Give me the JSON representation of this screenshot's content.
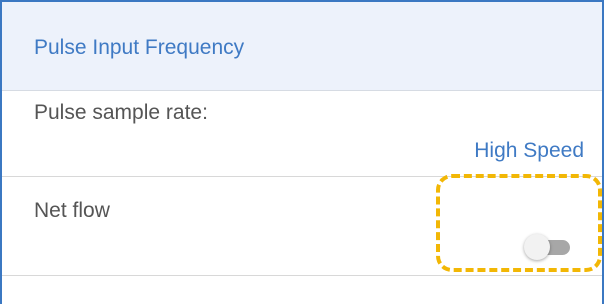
{
  "header": {
    "title": "Pulse Input Frequency"
  },
  "settings": [
    {
      "label": "Pulse sample rate:",
      "value": "High Speed"
    },
    {
      "label": "Net flow",
      "toggle": {
        "on": false
      }
    }
  ],
  "colors": {
    "accent": "#3f7ac4",
    "frame": "#3b78c2",
    "header_bg": "#edf2fb",
    "highlight": "#f2b705"
  }
}
